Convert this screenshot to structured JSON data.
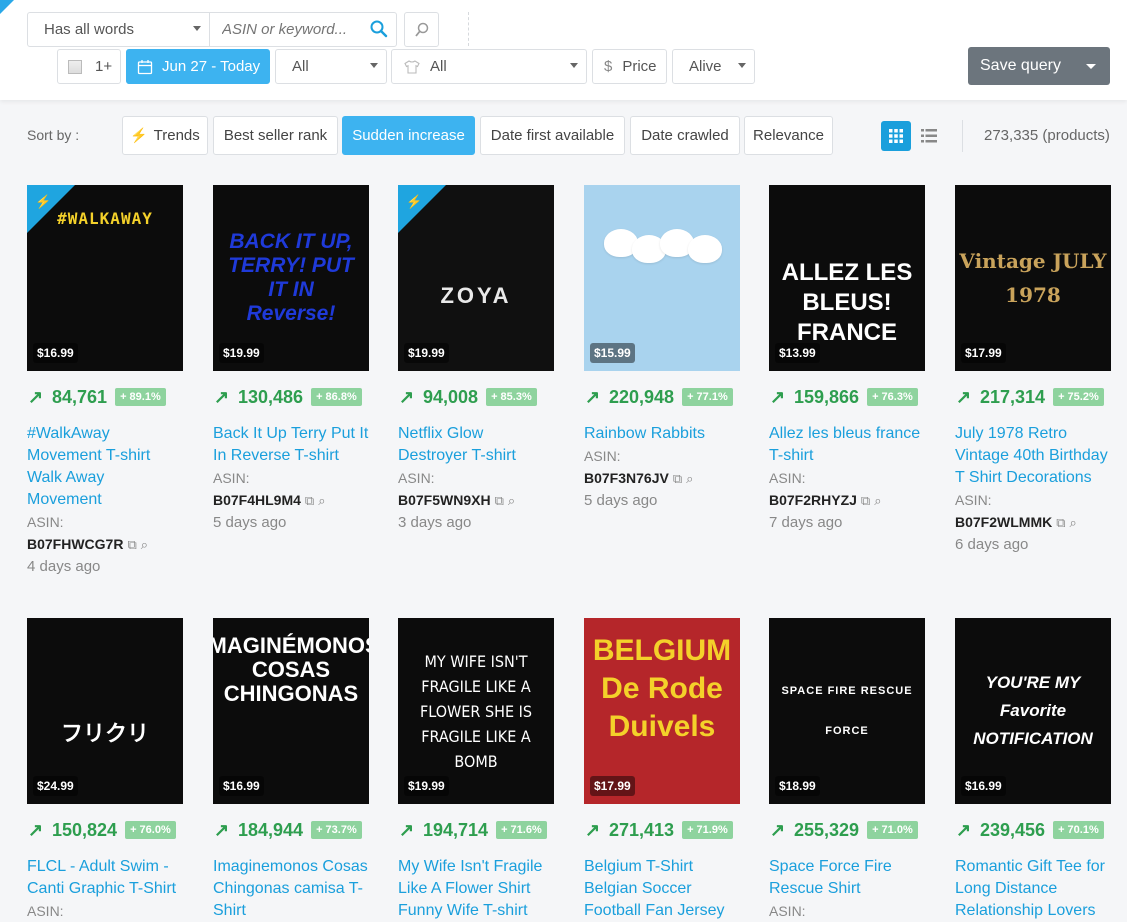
{
  "search": {
    "match_mode": "Has all words",
    "placeholder": "ASIN or keyword...",
    "min_count": "1+",
    "date_range": "Jun 27 - Today",
    "category": "All",
    "type": "All",
    "price": "Price",
    "status": "Alive",
    "save_label": "Save query"
  },
  "sort": {
    "label": "Sort by :",
    "options": [
      "Trends",
      "Best seller rank",
      "Sudden increase",
      "Date first available",
      "Date crawled",
      "Relevance"
    ],
    "active": "Sudden increase"
  },
  "product_count": "273,335 (products)",
  "colors": {
    "accent": "#3db3f0",
    "rank_green": "#2e9e4f",
    "pct_bg": "#8ed39e",
    "title_blue": "#1a9fdc"
  },
  "products": [
    {
      "price": "$16.99",
      "rank": "84,761",
      "pct": "+ 89.1%",
      "title": "#WalkAway Movement T-shirt Walk Away Movement",
      "asin_label": "ASIN:",
      "asin": "B07FHWCG7R",
      "ago": "4 days ago",
      "trending": true,
      "bg": "#0c0c0c",
      "art": "#WALKAWAY"
    },
    {
      "price": "$19.99",
      "rank": "130,486",
      "pct": "+ 86.8%",
      "title": "Back It Up Terry Put It In Reverse T-shirt",
      "asin_label": "ASIN:",
      "asin": "B07F4HL9M4",
      "ago": "5 days ago",
      "trending": false,
      "bg": "#0c0c0c",
      "art": "BACK IT UP, TERRY! PUT IT IN Reverse!"
    },
    {
      "price": "$19.99",
      "rank": "94,008",
      "pct": "+ 85.3%",
      "title": "Netflix Glow Destroyer T-shirt",
      "asin_label": "ASIN:",
      "asin": "B07F5WN9XH",
      "ago": "3 days ago",
      "trending": true,
      "bg": "#101010",
      "art": "ZOYA"
    },
    {
      "price": "$15.99",
      "rank": "220,948",
      "pct": "+ 77.1%",
      "title": "Rainbow Rabbits",
      "asin_label": "ASIN:",
      "asin": "B07F3N76JV",
      "ago": "5 days ago",
      "trending": false,
      "bg": "#a9d3ee",
      "art": ""
    },
    {
      "price": "$13.99",
      "rank": "159,866",
      "pct": "+ 76.3%",
      "title": "Allez les bleus france T-shirt",
      "asin_label": "ASIN:",
      "asin": "B07F2RHYZJ",
      "ago": "7 days ago",
      "trending": false,
      "bg": "#0c0c0c",
      "art": "ALLEZ LES BLEUS! FRANCE"
    },
    {
      "price": "$17.99",
      "rank": "217,314",
      "pct": "+ 75.2%",
      "title": "July 1978 Retro Vintage 40th Birthday T Shirt Decorations",
      "asin_label": "ASIN:",
      "asin": "B07F2WLMMK",
      "ago": "6 days ago",
      "trending": false,
      "bg": "#0c0c0c",
      "art": "Vintage JULY 1978"
    },
    {
      "price": "$24.99",
      "rank": "150,824",
      "pct": "+ 76.0%",
      "title": "FLCL - Adult Swim - Canti Graphic T-Shirt",
      "asin_label": "ASIN:",
      "asin": "",
      "ago": "",
      "trending": false,
      "bg": "#0c0c0c",
      "art": "フリクリ"
    },
    {
      "price": "$16.99",
      "rank": "184,944",
      "pct": "+ 73.7%",
      "title": "Imaginemonos Cosas Chingonas camisa T-Shirt",
      "asin_label": "",
      "asin": "",
      "ago": "",
      "trending": false,
      "bg": "#0c0c0c",
      "art": "IMAGINÉMONOS COSAS CHINGONAS"
    },
    {
      "price": "$19.99",
      "rank": "194,714",
      "pct": "+ 71.6%",
      "title": "My Wife Isn't Fragile Like A Flower Shirt Funny Wife T-shirt",
      "asin_label": "",
      "asin": "",
      "ago": "",
      "trending": false,
      "bg": "#0c0c0c",
      "art": "MY WIFE ISN'T FRAGILE LIKE A FLOWER SHE IS FRAGILE LIKE A BOMB"
    },
    {
      "price": "$17.99",
      "rank": "271,413",
      "pct": "+ 71.9%",
      "title": "Belgium T-Shirt Belgian Soccer Football Fan Jersey",
      "asin_label": "",
      "asin": "",
      "ago": "",
      "trending": false,
      "bg": "#b5262a",
      "art": "BELGIUM De Rode Duivels"
    },
    {
      "price": "$18.99",
      "rank": "255,329",
      "pct": "+ 71.0%",
      "title": "Space Force Fire Rescue Shirt",
      "asin_label": "ASIN:",
      "asin": "",
      "ago": "",
      "trending": false,
      "bg": "#0c0c0c",
      "art": "SPACE FIRE RESCUE FORCE"
    },
    {
      "price": "$16.99",
      "rank": "239,456",
      "pct": "+ 70.1%",
      "title": "Romantic Gift Tee for Long Distance Relationship Lovers",
      "asin_label": "",
      "asin": "",
      "ago": "",
      "trending": false,
      "bg": "#0c0c0c",
      "art": "YOU'RE MY Favorite NOTIFICATION"
    }
  ]
}
